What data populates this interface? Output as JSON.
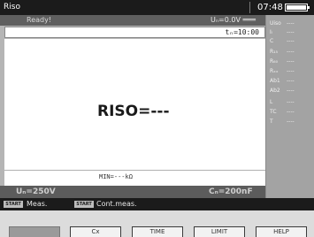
{
  "title_bar": {
    "title": "Riso",
    "time": "07:48",
    "battery_level": 1.0
  },
  "status": {
    "state": "Ready!",
    "un_reading": "Uₙ=0.0V ═══"
  },
  "measurement": {
    "tn": "tₙ=10:00",
    "reading": "RISO=---",
    "min": "MIN=---kΩ"
  },
  "params": {
    "un": "Uₙ=250V",
    "cn": "Cₙ=200nF"
  },
  "side_panel": [
    {
      "label": "Uiso",
      "value": "----"
    },
    {
      "label": "Iₗ",
      "value": "----"
    },
    {
      "label": "C",
      "value": "----"
    },
    {
      "label": "R₁₅",
      "value": "----"
    },
    {
      "label": "R₆₀",
      "value": "----"
    },
    {
      "label": "Rₓₓ",
      "value": "----"
    },
    {
      "label": "Ab1",
      "value": "----"
    },
    {
      "label": "Ab2",
      "value": "----"
    },
    {
      "label": "L",
      "value": "----"
    },
    {
      "label": "TC",
      "value": "----"
    },
    {
      "label": "T",
      "value": "----"
    }
  ],
  "hints": [
    {
      "key": "START",
      "text": "Meas."
    },
    {
      "key": "START",
      "text": "Cont.meas."
    }
  ],
  "function_keys": [
    "",
    "Cx",
    "TIME",
    "LIMIT",
    "HELP"
  ],
  "colors": {
    "title_bar": "#1b1b1b",
    "screen_bg": "#b5b5b5",
    "status_bar": "#5f5f5f",
    "side_panel": "#a3a3a3"
  }
}
